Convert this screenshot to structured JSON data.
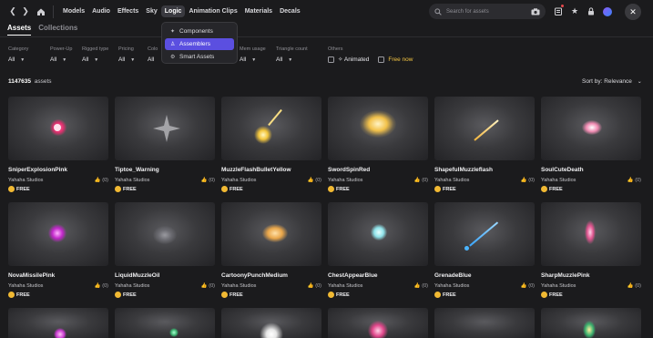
{
  "nav": {
    "back_icon": "chevron-left-icon",
    "forward_icon": "chevron-right-icon",
    "home_icon": "home-icon",
    "items": [
      "Models",
      "Audio",
      "Effects",
      "Sky",
      "Logic",
      "Animation Clips",
      "Materials",
      "Decals"
    ],
    "active": "Logic"
  },
  "search": {
    "placeholder": "Search for assets",
    "icon": "search-icon",
    "camera_icon": "camera-icon"
  },
  "dropdown": {
    "items": [
      {
        "label": "Components",
        "icon": "puzzle-icon"
      },
      {
        "label": "Assemblers",
        "icon": "assembler-icon"
      },
      {
        "label": "Smart Assets",
        "icon": "smart-asset-icon"
      }
    ],
    "active": "Assemblers"
  },
  "tabs": [
    "Assets",
    "Collections"
  ],
  "filters": {
    "category": {
      "label": "Category",
      "value": "All"
    },
    "power_up": {
      "label": "Power-Up",
      "value": "All"
    },
    "rigged_type": {
      "label": "Rigged type",
      "value": "All"
    },
    "pricing": {
      "label": "Pricing",
      "value": "All"
    },
    "color": {
      "label": "Colo",
      "value": "All"
    },
    "mem_usage": {
      "label": "Mem usage",
      "value": "All"
    },
    "triangle_count": {
      "label": "Triangle count",
      "value": "All"
    },
    "others": {
      "label": "Others",
      "animated": "Animated",
      "free_now": "Free now"
    }
  },
  "results": {
    "count": "1147635",
    "unit": "assets",
    "sort_label": "Sort by: Relevance"
  },
  "assets": [
    {
      "name": "SniperExplosionPink",
      "creator": "Yahaha Studios",
      "likes": "(0)",
      "price": "FREE"
    },
    {
      "name": "Tiptoe_Warning",
      "creator": "Yahaha Studios",
      "likes": "(0)",
      "price": "FREE"
    },
    {
      "name": "MuzzleFlashBulletYellow",
      "creator": "Yahaha Studios",
      "likes": "(0)",
      "price": "FREE"
    },
    {
      "name": "SwordSpinRed",
      "creator": "Yahaha Studios",
      "likes": "(0)",
      "price": "FREE"
    },
    {
      "name": "ShapefulMuzzleflash",
      "creator": "Yahaha Studios",
      "likes": "(0)",
      "price": "FREE"
    },
    {
      "name": "SoulCuteDeath",
      "creator": "Yahaha Studios",
      "likes": "(0)",
      "price": "FREE"
    },
    {
      "name": "NovaMissilePink",
      "creator": "Yahaha Studios",
      "likes": "(0)",
      "price": "FREE"
    },
    {
      "name": "LiquidMuzzleOil",
      "creator": "Yahaha Studios",
      "likes": "(0)",
      "price": "FREE"
    },
    {
      "name": "CartoonyPunchMedium",
      "creator": "Yahaha Studios",
      "likes": "(0)",
      "price": "FREE"
    },
    {
      "name": "ChestAppearBlue",
      "creator": "Yahaha Studios",
      "likes": "(0)",
      "price": "FREE"
    },
    {
      "name": "GrenadeBlue",
      "creator": "Yahaha Studios",
      "likes": "(0)",
      "price": "FREE"
    },
    {
      "name": "SharpMuzzlePink",
      "creator": "Yahaha Studios",
      "likes": "(0)",
      "price": "FREE"
    }
  ],
  "colors": {
    "accent": "#5b4fe0",
    "free": "#f4c542",
    "coin": "#f1b933",
    "background": "#1b1b1d"
  }
}
